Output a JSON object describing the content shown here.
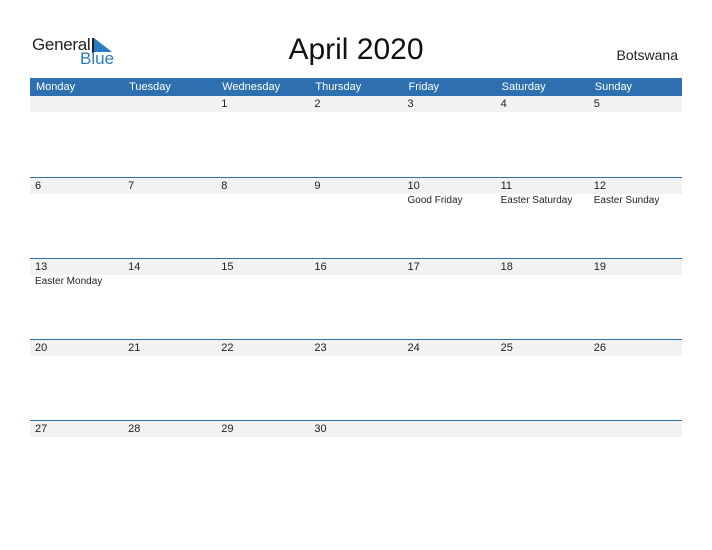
{
  "logo": {
    "text_general": "General",
    "text_blue": "Blue"
  },
  "title": "April 2020",
  "country": "Botswana",
  "colors": {
    "header_bg": "#2e6fb0",
    "row_bg": "#f2f2f2",
    "logo_blue": "#2a7ac4"
  },
  "weekdays": [
    "Monday",
    "Tuesday",
    "Wednesday",
    "Thursday",
    "Friday",
    "Saturday",
    "Sunday"
  ],
  "weeks": [
    {
      "days": [
        "",
        "",
        "1",
        "2",
        "3",
        "4",
        "5"
      ],
      "events": [
        "",
        "",
        "",
        "",
        "",
        "",
        ""
      ]
    },
    {
      "days": [
        "6",
        "7",
        "8",
        "9",
        "10",
        "11",
        "12"
      ],
      "events": [
        "",
        "",
        "",
        "",
        "Good Friday",
        "Easter Saturday",
        "Easter Sunday"
      ]
    },
    {
      "days": [
        "13",
        "14",
        "15",
        "16",
        "17",
        "18",
        "19"
      ],
      "events": [
        "Easter Monday",
        "",
        "",
        "",
        "",
        "",
        ""
      ]
    },
    {
      "days": [
        "20",
        "21",
        "22",
        "23",
        "24",
        "25",
        "26"
      ],
      "events": [
        "",
        "",
        "",
        "",
        "",
        "",
        ""
      ]
    },
    {
      "days": [
        "27",
        "28",
        "29",
        "30",
        "",
        "",
        ""
      ],
      "events": [
        "",
        "",
        "",
        "",
        "",
        "",
        ""
      ]
    }
  ]
}
